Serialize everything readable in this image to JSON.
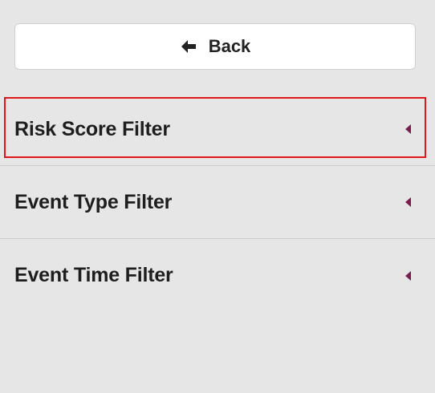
{
  "back_button": {
    "label": "Back",
    "icon": "arrow-left-icon"
  },
  "menu": {
    "items": [
      {
        "label": "Risk Score Filter",
        "icon": "caret-left-icon",
        "highlighted": true
      },
      {
        "label": "Event Type Filter",
        "icon": "caret-left-icon",
        "highlighted": false
      },
      {
        "label": "Event Time Filter",
        "icon": "caret-left-icon",
        "highlighted": false
      }
    ]
  },
  "colors": {
    "background": "#e6e6e6",
    "caret": "#7a1c4e",
    "highlight_border": "#e0161b"
  }
}
